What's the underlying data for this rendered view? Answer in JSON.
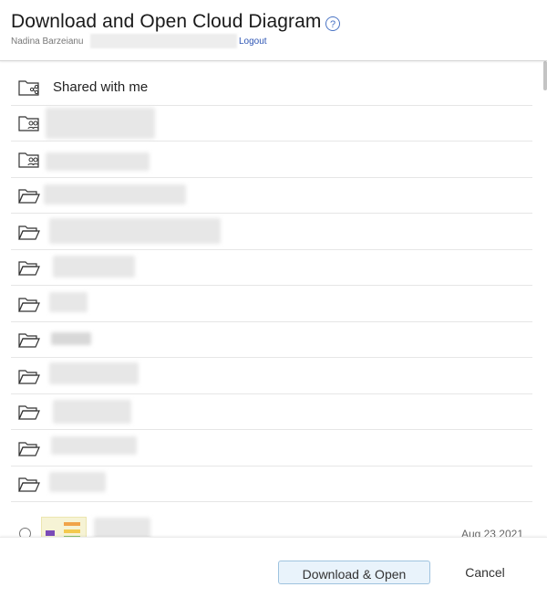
{
  "dialog": {
    "title": "Download and Open Cloud Diagram",
    "help_glyph": "?",
    "user_name": "Nadina Barzeianu",
    "logout_label": "Logout"
  },
  "list": {
    "shared_label": "Shared with me",
    "file": {
      "date": "Aug 23 2021"
    }
  },
  "footer": {
    "primary_label": "Download & Open",
    "cancel_label": "Cancel"
  }
}
